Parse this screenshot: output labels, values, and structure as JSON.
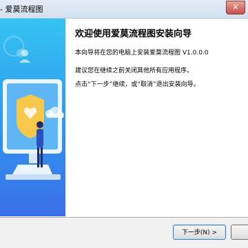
{
  "window": {
    "title": "- 爱莫流程图",
    "close_glyph": "✕"
  },
  "content": {
    "heading": "欢迎使用爱莫流程图安装向导",
    "para1": "本向导将在您的电脑上安装爱莫流程图 V1.0.0.0",
    "para2": "建议您在继续之前关闭其他所有应用程序。",
    "para3": "点击“下一步”继续，或“取消”退出安装向导。"
  },
  "buttons": {
    "next_label": "下一步(N) >",
    "cancel_label": ""
  },
  "colors": {
    "hero_top": "#35c4f1",
    "hero_bottom": "#3a6ee8",
    "accent_yellow": "#f7c84a",
    "figure_dark": "#1e2a6b"
  },
  "icons": [
    "close-icon",
    "person-icon",
    "monitor-icon",
    "shield-icon",
    "cloud-icon"
  ]
}
